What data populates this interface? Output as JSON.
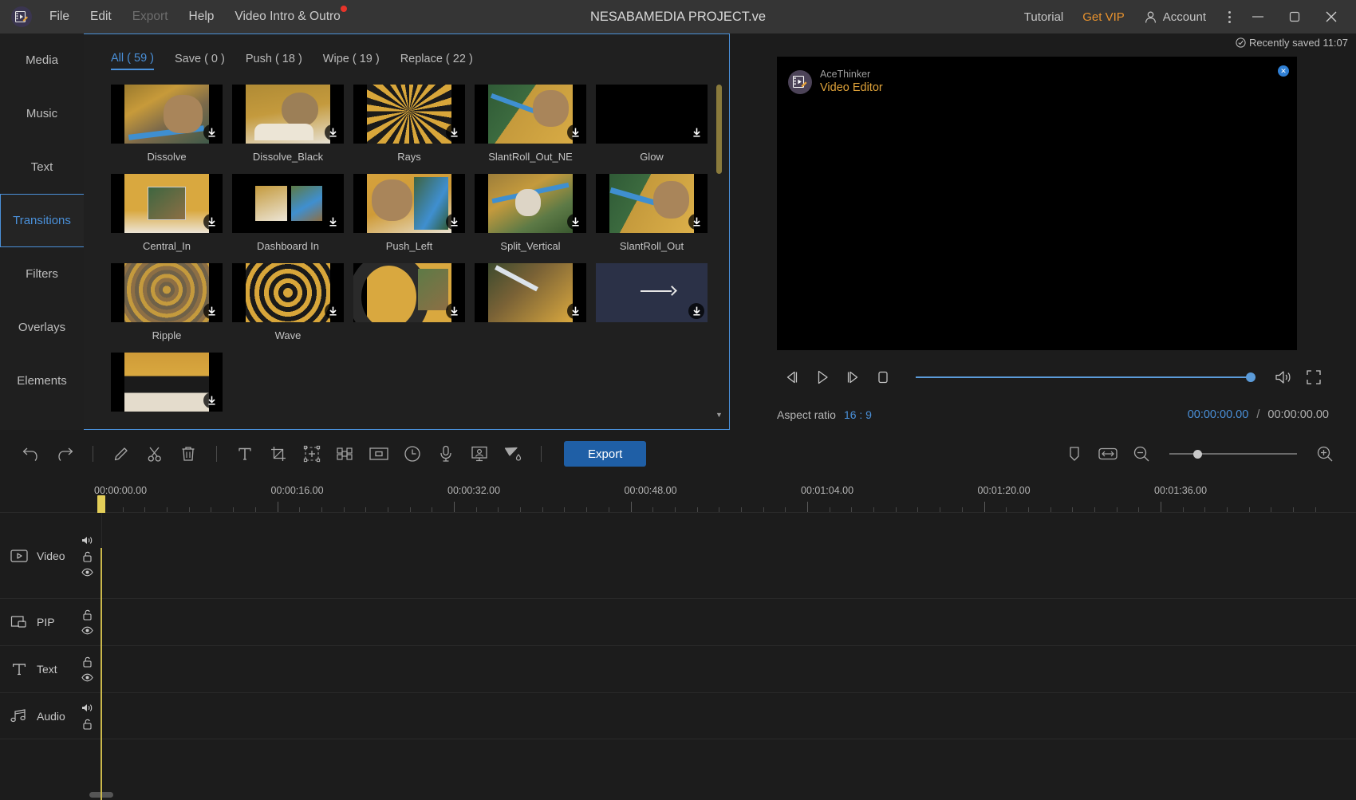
{
  "titlebar": {
    "logo_icon": "app-logo-icon",
    "menus": [
      {
        "label": "File",
        "dim": false,
        "badge": false
      },
      {
        "label": "Edit",
        "dim": false,
        "badge": false
      },
      {
        "label": "Export",
        "dim": true,
        "badge": false
      },
      {
        "label": "Help",
        "dim": false,
        "badge": false
      },
      {
        "label": "Video Intro & Outro",
        "dim": false,
        "badge": true
      }
    ],
    "project_title": "NESABAMEDIA PROJECT.ve",
    "tutorial": "Tutorial",
    "get_vip": "Get VIP",
    "account": "Account",
    "minimize": "—",
    "maximize": "□",
    "close": "✕"
  },
  "sidebar": {
    "items": [
      {
        "label": "Media",
        "active": false
      },
      {
        "label": "Music",
        "active": false
      },
      {
        "label": "Text",
        "active": false
      },
      {
        "label": "Transitions",
        "active": true
      },
      {
        "label": "Filters",
        "active": false
      },
      {
        "label": "Overlays",
        "active": false
      },
      {
        "label": "Elements",
        "active": false
      }
    ],
    "accent": "#4a90d9"
  },
  "browser": {
    "tabs": [
      {
        "label": "All ( 59 )",
        "active": true
      },
      {
        "label": "Save ( 0 )",
        "active": false
      },
      {
        "label": "Push ( 18 )",
        "active": false
      },
      {
        "label": "Wipe ( 19 )",
        "active": false
      },
      {
        "label": "Replace ( 22 )",
        "active": false
      }
    ],
    "items": [
      {
        "label": "Dissolve",
        "style": "dissolve"
      },
      {
        "label": "Dissolve_Black",
        "style": "dissolve-black"
      },
      {
        "label": "Rays",
        "style": "rays"
      },
      {
        "label": "SlantRoll_Out_NE",
        "style": "slantroll-ne"
      },
      {
        "label": "Glow",
        "style": "glow"
      },
      {
        "label": "Central_In",
        "style": "central-in"
      },
      {
        "label": "Dashboard In",
        "style": "dashboard-in"
      },
      {
        "label": "Push_Left",
        "style": "push-left"
      },
      {
        "label": "Split_Vertical",
        "style": "split-vertical"
      },
      {
        "label": "SlantRoll_Out",
        "style": "slantroll-out"
      },
      {
        "label": "Ripple",
        "style": "ripple"
      },
      {
        "label": "Wave",
        "style": "wave"
      },
      {
        "label": "",
        "style": "partial-a"
      },
      {
        "label": "",
        "style": "partial-b"
      },
      {
        "label": "",
        "style": "partial-c"
      },
      {
        "label": "",
        "style": "partial-d"
      }
    ],
    "download_icon": "download-icon"
  },
  "preview": {
    "saved_status": "Recently saved 11:07",
    "saved_icon": "check-circle-icon",
    "watermark_brand": "AceThinker",
    "watermark_product": "Video Editor",
    "close_watermark": "✕",
    "controls": [
      {
        "name": "previous-frame",
        "icon": "previous-frame-icon"
      },
      {
        "name": "play",
        "icon": "play-icon"
      },
      {
        "name": "next-frame",
        "icon": "next-frame-icon"
      },
      {
        "name": "stop",
        "icon": "stop-icon"
      }
    ],
    "volume_icon": "volume-icon",
    "fullscreen_icon": "fullscreen-icon",
    "aspect_label": "Aspect ratio",
    "aspect_value": "16 : 9",
    "current_time": "00:00:00.00",
    "time_separator": "/",
    "total_time": "00:00:00.00",
    "seek_percent": 100
  },
  "toolbar": {
    "tools": [
      {
        "name": "undo",
        "icon": "undo-icon"
      },
      {
        "name": "redo",
        "icon": "redo-icon"
      },
      {
        "name": "edit",
        "icon": "pencil-icon"
      },
      {
        "name": "split",
        "icon": "scissors-icon"
      },
      {
        "name": "delete",
        "icon": "trash-icon"
      },
      {
        "name": "text",
        "icon": "text-icon"
      },
      {
        "name": "crop",
        "icon": "crop-icon"
      },
      {
        "name": "transform",
        "icon": "transform-icon"
      },
      {
        "name": "mosaic",
        "icon": "mosaic-icon"
      },
      {
        "name": "pip",
        "icon": "pip-frame-icon"
      },
      {
        "name": "speed",
        "icon": "clock-icon"
      },
      {
        "name": "voiceover",
        "icon": "microphone-icon"
      },
      {
        "name": "green-screen",
        "icon": "green-screen-icon"
      },
      {
        "name": "color-correct",
        "icon": "paint-bucket-icon"
      }
    ],
    "export_label": "Export",
    "marker_icon": "marker-icon",
    "fit-screen_icon": "fit-to-screen-icon",
    "zoom_out_icon": "zoom-out-icon",
    "zoom_in_icon": "zoom-in-icon",
    "zoom_percent": 22
  },
  "timeline": {
    "ruler_labels": [
      "00:00:00.00",
      "00:00:16.00",
      "00:00:32.00",
      "00:00:48.00",
      "00:01:04.00",
      "00:01:20.00",
      "00:01:36.00"
    ],
    "playhead_time": "00:00:00.00",
    "tracks": [
      {
        "label": "Video",
        "icon": "video-track-icon",
        "volume": true,
        "lock": true,
        "eye": true
      },
      {
        "label": "PIP",
        "icon": "pip-track-icon",
        "volume": false,
        "lock": true,
        "eye": true
      },
      {
        "label": "Text",
        "icon": "text-track-icon",
        "volume": false,
        "lock": true,
        "eye": true
      },
      {
        "label": "Audio",
        "icon": "audio-track-icon",
        "volume": true,
        "lock": true,
        "eye": false
      }
    ]
  }
}
